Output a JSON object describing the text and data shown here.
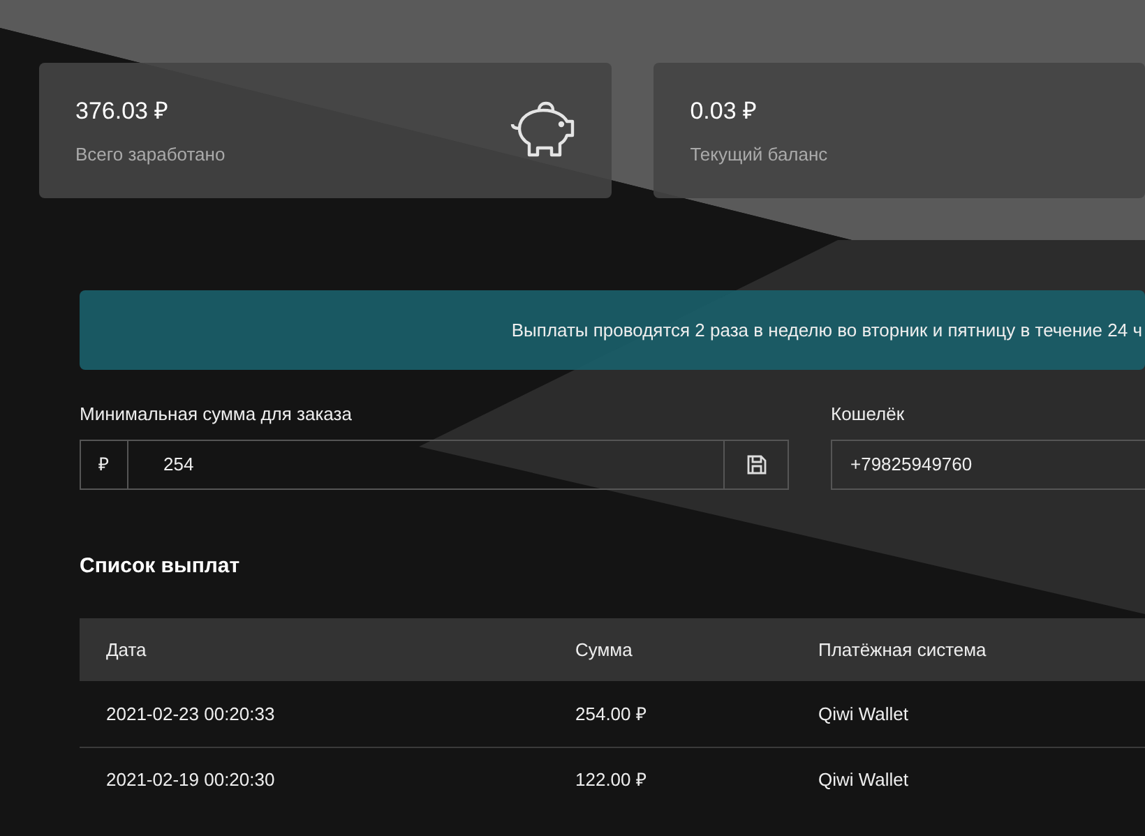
{
  "stats": [
    {
      "amount": "376.03 ₽",
      "label": "Всего заработано",
      "kind": "iconed"
    },
    {
      "amount": "0.03 ₽",
      "label": "Текущий баланс",
      "kind": "plain"
    }
  ],
  "notice": "Выплаты проводятся 2 раза в неделю во вторник и пятницу в течение 24 ч",
  "min_amount": {
    "label": "Минимальная сумма для заказа",
    "prefix": "₽",
    "value": "254"
  },
  "wallet": {
    "label": "Кошелёк",
    "value": "+79825949760"
  },
  "payouts": {
    "title": "Список выплат",
    "columns": [
      "Дата",
      "Сумма",
      "Платёжная система"
    ],
    "rows": [
      [
        "2021-02-23 00:20:33",
        "254.00 ₽",
        "Qiwi Wallet"
      ],
      [
        "2021-02-19 00:20:30",
        "122.00 ₽",
        "Qiwi Wallet"
      ]
    ]
  }
}
